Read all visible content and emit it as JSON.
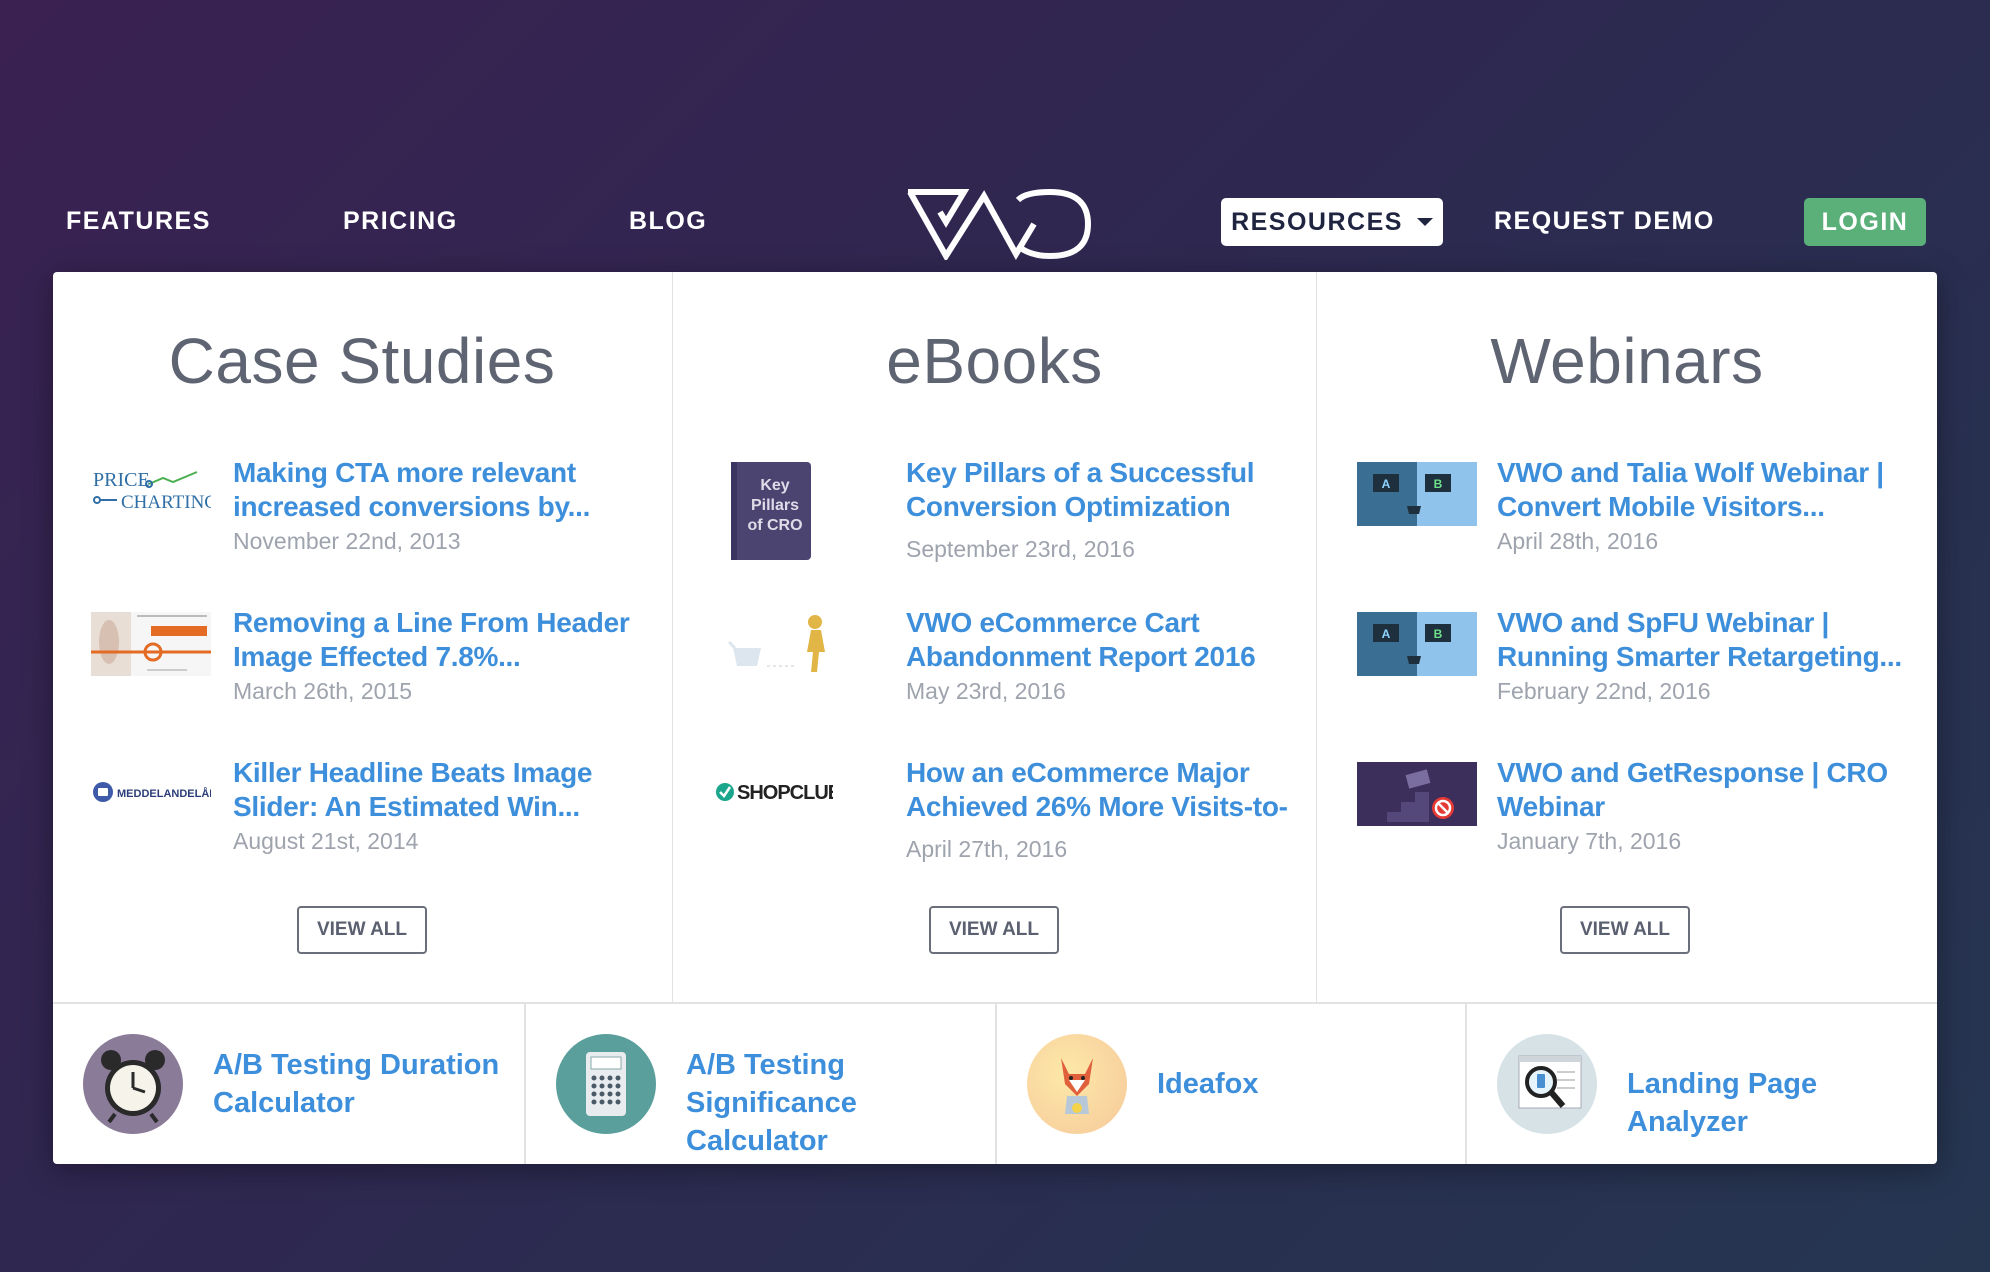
{
  "nav": {
    "features": "FEATURES",
    "pricing": "PRICING",
    "blog": "BLOG",
    "resources": "RESOURCES",
    "request_demo": "REQUEST DEMO",
    "login": "LOGIN",
    "logo_icon": "vwo-logo-icon"
  },
  "colors": {
    "accent_link": "#3d8fdb",
    "login_green": "#5bb07a",
    "title_gray": "#5f6473",
    "date_gray": "#9ea3ad"
  },
  "columns": [
    {
      "title": "Case Studies",
      "items": [
        {
          "title_l1": "Making CTA more relevant",
          "title_l2": "increased conversions by...",
          "date": "November 22nd, 2013",
          "thumb": "price-charting-logo",
          "logo_line1": "PRICE",
          "logo_line2": "CHARTING"
        },
        {
          "title_l1": "Removing a Line From Header",
          "title_l2": "Image Effected 7.8%...",
          "date": "March 26th, 2015",
          "thumb": "header-image-thumb"
        },
        {
          "title_l1": "Killer Headline Beats Image",
          "title_l2": "Slider: An Estimated Win...",
          "date": "August 21st, 2014",
          "thumb": "meddelandelan-logo",
          "logo_text": "MEDDELANDELÅN"
        }
      ],
      "view_all": "VIEW ALL"
    },
    {
      "title": "eBooks",
      "items": [
        {
          "title_l1": "Key Pillars of a Successful",
          "title_l2": "Conversion Optimization",
          "date": "September 23rd, 2016",
          "thumb": "key-pillars-book",
          "book_l1": "Key",
          "book_l2": "Pillars",
          "book_l3": "of CRO"
        },
        {
          "title_l1": "VWO eCommerce Cart",
          "title_l2": "Abandonment Report 2016",
          "date": "May 23rd, 2016",
          "thumb": "cart-walkaway-thumb"
        },
        {
          "title_l1": "How an eCommerce Major",
          "title_l2": "Achieved 26% More Visits-to-",
          "date": "April 27th, 2016",
          "thumb": "shopclues-logo",
          "logo_text": "SHOPCLUES"
        }
      ],
      "view_all": "VIEW ALL"
    },
    {
      "title": "Webinars",
      "items": [
        {
          "title_l1": "VWO and Talia Wolf Webinar |",
          "title_l2": "Convert Mobile Visitors...",
          "date": "April 28th, 2016",
          "thumb": "ab-screens-thumb",
          "a": "A",
          "b": "B"
        },
        {
          "title_l1": "VWO and SpFU Webinar |",
          "title_l2": "Running Smarter Retargeting...",
          "date": "February 22nd, 2016",
          "thumb": "ab-screens-thumb",
          "a": "A",
          "b": "B"
        },
        {
          "title_l1": "VWO and GetResponse | CRO",
          "title_l2": "Webinar",
          "date": "January 7th, 2016",
          "thumb": "blocked-stairs-thumb"
        }
      ],
      "view_all": "VIEW ALL"
    }
  ],
  "tools": [
    {
      "label_l1": "A/B Testing Duration",
      "label_l2": "Calculator",
      "icon": "alarm-clock-icon"
    },
    {
      "label_l1": "A/B Testing",
      "label_l2": "Significance Calculator",
      "icon": "calculator-icon"
    },
    {
      "label_l1": "Ideafox",
      "label_l2": "",
      "icon": "fox-icon"
    },
    {
      "label_l1": "Landing Page Analyzer",
      "label_l2": "",
      "icon": "magnifier-page-icon"
    }
  ]
}
